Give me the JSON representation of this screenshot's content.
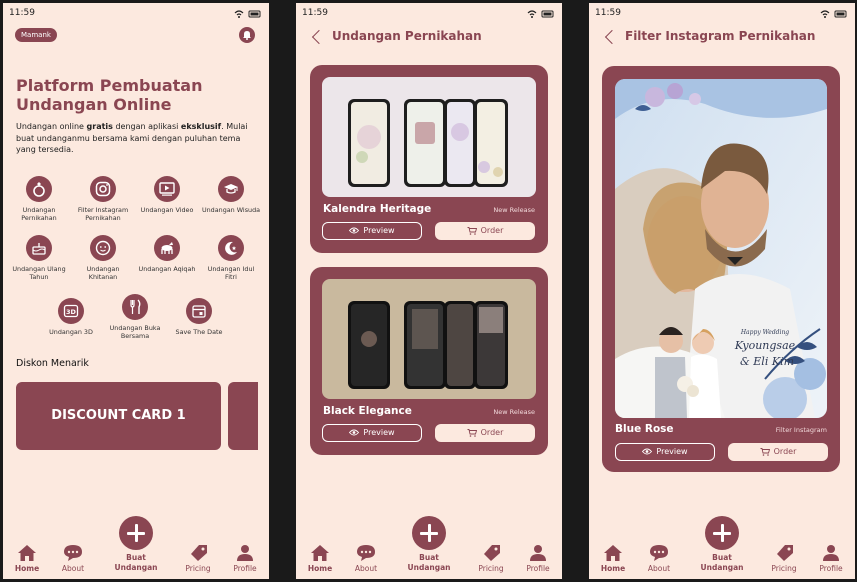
{
  "status_time": "11:59",
  "screen1": {
    "user_chip": "Mamank",
    "hero_title": "Platform Pembuatan Undangan Online",
    "hero_desc_1": "Undangan online ",
    "hero_desc_b1": "gratis",
    "hero_desc_2": " dengan aplikasi ",
    "hero_desc_b2": "eksklusif",
    "hero_desc_3": ". Mulai buat undanganmu bersama kami dengan puluhan tema yang tersedia.",
    "features": [
      {
        "label": "Undangan Pernikahan",
        "icon": "ring-icon"
      },
      {
        "label": "Filter Instagram Pernikahan",
        "icon": "instagram-icon"
      },
      {
        "label": "Undangan Video",
        "icon": "video-icon"
      },
      {
        "label": "Undangan Wisuda",
        "icon": "graduation-cap-icon"
      },
      {
        "label": "Undangan Ulang Tahun",
        "icon": "cake-icon"
      },
      {
        "label": "Undangan Khitanan",
        "icon": "baby-face-icon"
      },
      {
        "label": "Undangan Aqiqah",
        "icon": "goat-icon"
      },
      {
        "label": "Undangan Idul Fitri",
        "icon": "crescent-icon"
      },
      {
        "label": "Undangan 3D",
        "icon": "3d-icon"
      },
      {
        "label": "Undangan Buka Bersama",
        "icon": "utensils-icon"
      },
      {
        "label": "Save The Date",
        "icon": "calendar-icon"
      }
    ],
    "section_title": "Diskon Menarik",
    "discount_card": "DISCOUNT CARD 1"
  },
  "screen2": {
    "title": "Undangan Pernikahan",
    "cards": [
      {
        "name": "Kalendra Heritage",
        "tag": "New Release"
      },
      {
        "name": "Black Elegance",
        "tag": "New Release"
      }
    ]
  },
  "screen3": {
    "title": "Filter Instagram Pernikahan",
    "card": {
      "name": "Blue Rose",
      "tag": "Filter Instagram"
    }
  },
  "buttons": {
    "preview": "Preview",
    "order": "Order"
  },
  "nav": {
    "home": "Home",
    "about": "About",
    "create_1": "Buat",
    "create_2": "Undangan",
    "pricing": "Pricing",
    "profile": "Profile"
  },
  "colors": {
    "brand": "#8a4652",
    "background": "#fce9df"
  }
}
